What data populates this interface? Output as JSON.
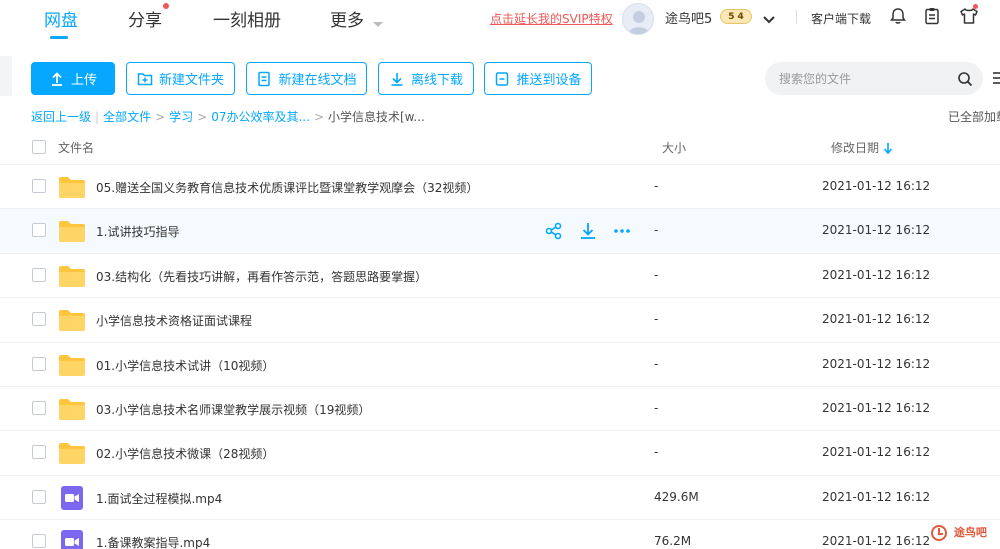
{
  "nav": {
    "tabs": [
      "网盘",
      "分享",
      "一刻相册",
      "更多"
    ],
    "svip_link": "点击延长我的SVIP特权",
    "username": "途鸟吧5",
    "vip_level": "5",
    "vip_count": "4",
    "client_download": "客户端下载"
  },
  "toolbar": {
    "upload": "上传",
    "new_folder": "新建文件夹",
    "new_doc": "新建在线文档",
    "offline_download": "离线下载",
    "push_device": "推送到设备"
  },
  "search": {
    "placeholder": "搜索您的文件"
  },
  "breadcrumb": {
    "back": "返回上一级",
    "all_files": "全部文件",
    "study": "学习",
    "folder1": "07办公效率及其...",
    "current": "小学信息技术[w...",
    "loaded": "已全部加载"
  },
  "table": {
    "col_name": "文件名",
    "col_size": "大小",
    "col_date": "修改日期",
    "rows": [
      {
        "name": "05.赠送全国义务教育信息技术优质课评比暨课堂教学观摩会（32视频）",
        "size": "-",
        "date": "2021-01-12 16:12",
        "type": "folder"
      },
      {
        "name": "1.试讲技巧指导",
        "size": "-",
        "date": "2021-01-12 16:12",
        "type": "folder"
      },
      {
        "name": "03.结构化（先看技巧讲解，再看作答示范，答题思路要掌握）",
        "size": "-",
        "date": "2021-01-12 16:12",
        "type": "folder"
      },
      {
        "name": "小学信息技术资格证面试课程",
        "size": "-",
        "date": "2021-01-12 16:12",
        "type": "folder"
      },
      {
        "name": "01.小学信息技术试讲（10视频）",
        "size": "-",
        "date": "2021-01-12 16:12",
        "type": "folder"
      },
      {
        "name": "03.小学信息技术名师课堂教学展示视频（19视频）",
        "size": "-",
        "date": "2021-01-12 16:12",
        "type": "folder"
      },
      {
        "name": "02.小学信息技术微课（28视频）",
        "size": "-",
        "date": "2021-01-12 16:12",
        "type": "folder"
      },
      {
        "name": "1.面试全过程模拟.mp4",
        "size": "429.6M",
        "date": "2021-01-12 16:12",
        "type": "video"
      },
      {
        "name": "1.备课教案指导.mp4",
        "size": "76.2M",
        "date": "2021-01-12 16:12",
        "type": "video"
      }
    ]
  },
  "watermark": "途鸟吧",
  "colors": {
    "accent": "#06a7ff",
    "folder": "#ffc53d",
    "video": "#7b68ee",
    "red": "#f25656"
  }
}
